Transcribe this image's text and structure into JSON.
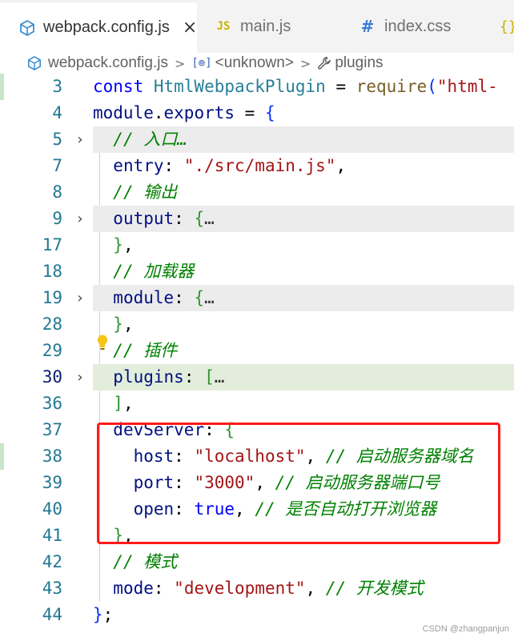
{
  "tabs": [
    {
      "icon": "webpack-cube-icon",
      "label": "webpack.config.js",
      "active": true
    },
    {
      "icon": "js-file-icon",
      "glyph": "JS",
      "label": "main.js",
      "active": false
    },
    {
      "icon": "css-file-icon",
      "glyph": "#",
      "label": "index.css",
      "active": false
    },
    {
      "icon": "json-file-icon",
      "glyph": "{}",
      "label": "",
      "active": false
    }
  ],
  "tab_close_glyph": "×",
  "breadcrumb": {
    "file": "webpack.config.js",
    "unknown": "<unknown>",
    "symbol_glyph": "[⊚]",
    "plugins": "plugins",
    "sep": ">"
  },
  "editor": {
    "lines": [
      {
        "n": "3",
        "tokens": [
          [
            "kw",
            "const "
          ],
          [
            "cls",
            "HtmlWebpackPlugin"
          ],
          [
            "pun",
            " = "
          ],
          [
            "fn",
            "require"
          ],
          [
            "brk1",
            "("
          ],
          [
            "str",
            "\"html-"
          ]
        ]
      },
      {
        "n": "4",
        "tokens": [
          [
            "prop",
            "module"
          ],
          [
            "pun",
            "."
          ],
          [
            "prop",
            "exports"
          ],
          [
            "pun",
            " = "
          ],
          [
            "brk1",
            "{"
          ]
        ]
      },
      {
        "n": "5",
        "fold": true,
        "folded": true,
        "tokens": [
          [
            "pun",
            "  "
          ],
          [
            "cm",
            "// 入口…"
          ]
        ]
      },
      {
        "n": "7",
        "tokens": [
          [
            "pun",
            "  "
          ],
          [
            "prop",
            "entry"
          ],
          [
            "pun",
            ": "
          ],
          [
            "str",
            "\"./src/main.js\""
          ],
          [
            "pun",
            ","
          ]
        ]
      },
      {
        "n": "8",
        "tokens": [
          [
            "pun",
            "  "
          ],
          [
            "cm",
            "// 输出"
          ]
        ]
      },
      {
        "n": "9",
        "fold": true,
        "folded": true,
        "tokens": [
          [
            "pun",
            "  "
          ],
          [
            "prop",
            "output"
          ],
          [
            "pun",
            ": "
          ],
          [
            "brk2",
            "{"
          ],
          [
            "ell",
            "…"
          ]
        ]
      },
      {
        "n": "17",
        "tokens": [
          [
            "pun",
            "  "
          ],
          [
            "brk2",
            "}"
          ],
          [
            "pun",
            ","
          ]
        ]
      },
      {
        "n": "18",
        "tokens": [
          [
            "pun",
            "  "
          ],
          [
            "cm",
            "// 加载器"
          ]
        ]
      },
      {
        "n": "19",
        "fold": true,
        "folded": true,
        "tokens": [
          [
            "pun",
            "  "
          ],
          [
            "prop",
            "module"
          ],
          [
            "pun",
            ": "
          ],
          [
            "brk2",
            "{"
          ],
          [
            "ell",
            "…"
          ]
        ]
      },
      {
        "n": "28",
        "tokens": [
          [
            "pun",
            "  "
          ],
          [
            "brk2",
            "}"
          ],
          [
            "pun",
            ","
          ]
        ]
      },
      {
        "n": "29",
        "tokens": [
          [
            "pun",
            "  "
          ],
          [
            "cm",
            "// 插件"
          ]
        ]
      },
      {
        "n": "30",
        "fold": true,
        "folded": true,
        "selected": true,
        "current": true,
        "tokens": [
          [
            "pun",
            "  "
          ],
          [
            "prop",
            "plugins"
          ],
          [
            "pun",
            ": "
          ],
          [
            "brk2",
            "["
          ],
          [
            "ell",
            "…"
          ]
        ]
      },
      {
        "n": "36",
        "tokens": [
          [
            "pun",
            "  "
          ],
          [
            "brk2",
            "]"
          ],
          [
            "pun",
            ","
          ]
        ]
      },
      {
        "n": "37",
        "tokens": [
          [
            "pun",
            "  "
          ],
          [
            "prop",
            "devServer"
          ],
          [
            "pun",
            ": "
          ],
          [
            "brk2",
            "{"
          ]
        ]
      },
      {
        "n": "38",
        "tokens": [
          [
            "pun",
            "    "
          ],
          [
            "prop",
            "host"
          ],
          [
            "pun",
            ": "
          ],
          [
            "str",
            "\"localhost\""
          ],
          [
            "pun",
            ", "
          ],
          [
            "cm",
            "// 启动服务器域名"
          ]
        ]
      },
      {
        "n": "39",
        "tokens": [
          [
            "pun",
            "    "
          ],
          [
            "prop",
            "port"
          ],
          [
            "pun",
            ": "
          ],
          [
            "str",
            "\"3000\""
          ],
          [
            "pun",
            ", "
          ],
          [
            "cm",
            "// 启动服务器端口号"
          ]
        ]
      },
      {
        "n": "40",
        "tokens": [
          [
            "pun",
            "    "
          ],
          [
            "prop",
            "open"
          ],
          [
            "pun",
            ": "
          ],
          [
            "bool",
            "true"
          ],
          [
            "pun",
            ", "
          ],
          [
            "cm",
            "// 是否自动打开浏览器"
          ]
        ]
      },
      {
        "n": "41",
        "tokens": [
          [
            "pun",
            "  "
          ],
          [
            "brk2",
            "}"
          ],
          [
            "pun",
            ","
          ]
        ]
      },
      {
        "n": "42",
        "tokens": [
          [
            "pun",
            "  "
          ],
          [
            "cm",
            "// 模式"
          ]
        ]
      },
      {
        "n": "43",
        "tokens": [
          [
            "pun",
            "  "
          ],
          [
            "prop",
            "mode"
          ],
          [
            "pun",
            ": "
          ],
          [
            "str",
            "\"development\""
          ],
          [
            "pun",
            ", "
          ],
          [
            "cm",
            "// 开发模式"
          ]
        ]
      },
      {
        "n": "44",
        "tokens": [
          [
            "brk1",
            "}"
          ],
          [
            "pun",
            ";"
          ]
        ]
      }
    ]
  },
  "watermark": "CSDN @zhangpanjun",
  "colors": {
    "highlight_box": "#ff1a1a",
    "folded_bg": "#ececec",
    "selected_fold_bg": "#e2eedb"
  }
}
